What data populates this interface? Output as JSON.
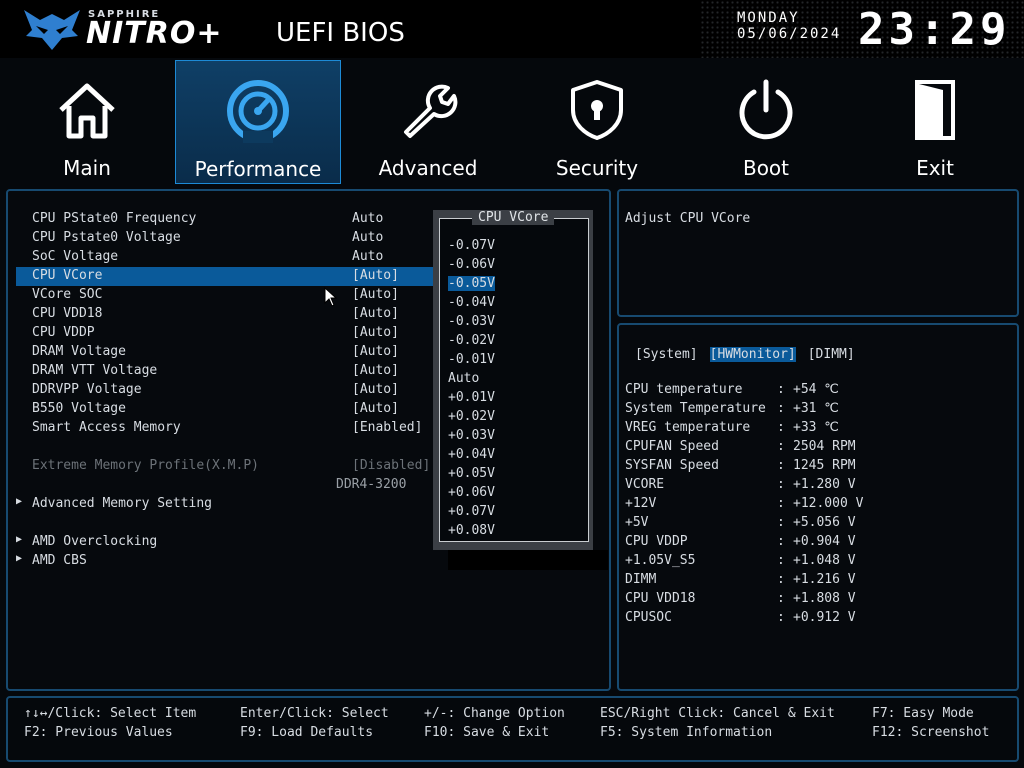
{
  "header": {
    "brand_small": "SAPPHIRE",
    "brand_big": "NITRO+",
    "title": "UEFI BIOS",
    "day": "MONDAY",
    "date": "05/06/2024",
    "time": "23:29"
  },
  "tabs": [
    {
      "label": "Main",
      "icon": "home-icon"
    },
    {
      "label": "Performance",
      "icon": "speedometer-icon",
      "active": true
    },
    {
      "label": "Advanced",
      "icon": "wrench-icon"
    },
    {
      "label": "Security",
      "icon": "shield-lock-icon"
    },
    {
      "label": "Boot",
      "icon": "power-icon"
    },
    {
      "label": "Exit",
      "icon": "door-exit-icon"
    }
  ],
  "settings": [
    {
      "name": "CPU PState0 Frequency",
      "value": "Auto"
    },
    {
      "name": "CPU Pstate0 Voltage",
      "value": "Auto"
    },
    {
      "name": "SoC Voltage",
      "value": "Auto"
    },
    {
      "name": "CPU VCore",
      "value": "[Auto]"
    },
    {
      "name": "VCore SOC",
      "value": "[Auto]"
    },
    {
      "name": "CPU VDD18",
      "value": "[Auto]"
    },
    {
      "name": "CPU VDDP",
      "value": "[Auto]"
    },
    {
      "name": "DRAM Voltage",
      "value": "[Auto]"
    },
    {
      "name": "DRAM VTT Voltage",
      "value": "[Auto]"
    },
    {
      "name": "DDRVPP Voltage",
      "value": "[Auto]"
    },
    {
      "name": "B550 Voltage",
      "value": "[Auto]"
    },
    {
      "name": "Smart Access Memory",
      "value": "[Enabled]"
    },
    {
      "name": "Extreme Memory Profile(X.M.P)",
      "value": "[Disabled]"
    },
    {
      "name": "",
      "value": "DDR4-3200"
    },
    {
      "name": "Advanced Memory Setting",
      "value": ""
    },
    {
      "name": "AMD Overclocking",
      "value": ""
    },
    {
      "name": "AMD CBS",
      "value": ""
    }
  ],
  "dropdown": {
    "title": "CPU VCore",
    "options": [
      "-0.07V",
      "-0.06V",
      "-0.05V",
      "-0.04V",
      "-0.03V",
      "-0.02V",
      "-0.01V",
      "Auto",
      "+0.01V",
      "+0.02V",
      "+0.03V",
      "+0.04V",
      "+0.05V",
      "+0.06V",
      "+0.07V",
      "+0.08V"
    ],
    "selected": "-0.05V"
  },
  "help": {
    "text": "Adjust CPU VCore"
  },
  "hwmonitor": {
    "tabs": [
      "[System]",
      "[HWMonitor]",
      "[DIMM]"
    ],
    "active_tab": "[HWMonitor]",
    "rows": [
      {
        "k": "CPU temperature",
        "v": "+54 ℃"
      },
      {
        "k": "System Temperature",
        "v": "+31 ℃"
      },
      {
        "k": "VREG temperature",
        "v": "+33 ℃"
      },
      {
        "k": "CPUFAN Speed",
        "v": "2504 RPM"
      },
      {
        "k": "SYSFAN Speed",
        "v": "1245 RPM"
      },
      {
        "k": "VCORE",
        "v": "+1.280 V"
      },
      {
        "k": "+12V",
        "v": "+12.000 V"
      },
      {
        "k": "+5V",
        "v": "+5.056 V"
      },
      {
        "k": "CPU VDDP",
        "v": "+0.904 V"
      },
      {
        "k": "+1.05V_S5",
        "v": "+1.048 V"
      },
      {
        "k": "DIMM",
        "v": "+1.216 V"
      },
      {
        "k": "CPU VDD18",
        "v": "+1.808 V"
      },
      {
        "k": "CPUSOC",
        "v": "+0.912 V"
      }
    ]
  },
  "footer": {
    "select_item": "↑↓↔/Click: Select Item",
    "select": "Enter/Click: Select",
    "change": "+/-: Change Option",
    "cancel": "ESC/Right Click: Cancel & Exit",
    "easy": "F7: Easy Mode",
    "prev": "F2: Previous Values",
    "load": "F9: Load Defaults",
    "save": "F10: Save & Exit",
    "sysinfo": "F5: System Information",
    "screenshot": "F12: Screenshot"
  },
  "colors": {
    "accent": "#0a5a9a",
    "border": "#174a70",
    "bg": "#05080c"
  }
}
